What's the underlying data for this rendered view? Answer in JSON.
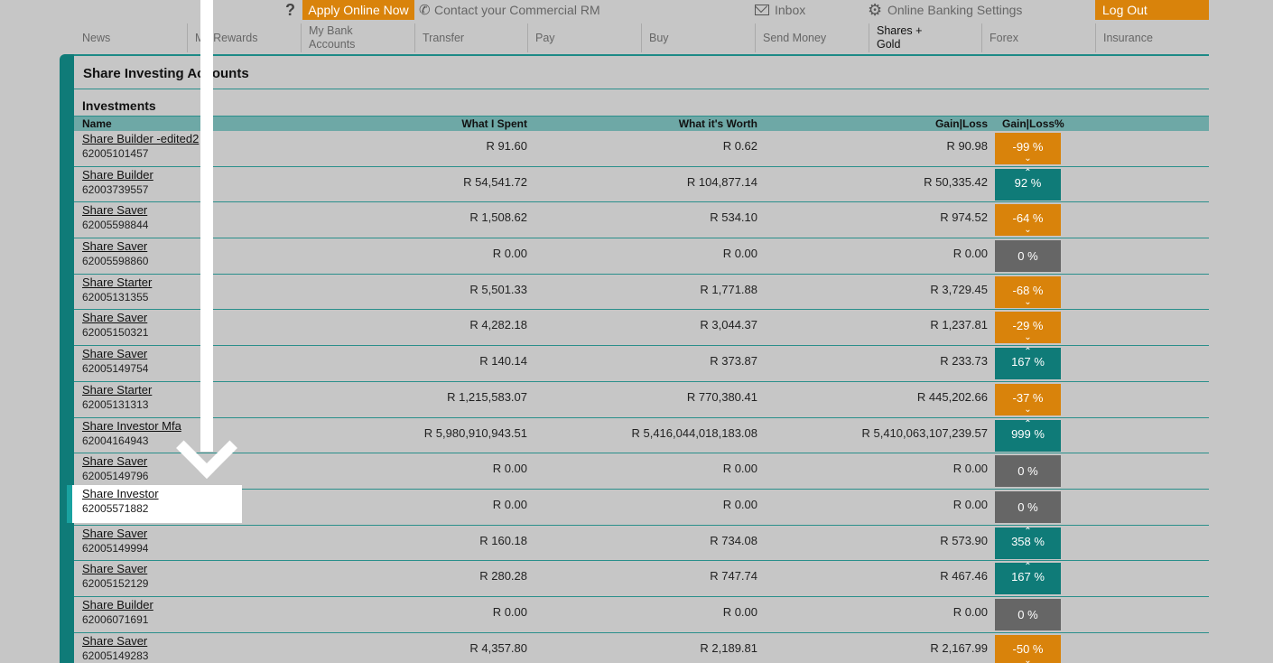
{
  "topbar": {
    "help": "?",
    "apply": "Apply Online Now",
    "contact": "Contact your Commercial RM",
    "inbox": "Inbox",
    "settings": "Online Banking Settings",
    "logout": "Log Out"
  },
  "nav": [
    "News",
    "My Rewards",
    "My Bank\nAccounts",
    "Transfer",
    "Pay",
    "Buy",
    "Send Money",
    "Shares +\nGold",
    "Forex",
    "Insurance"
  ],
  "panel": {
    "title": "Share Investing Accounts",
    "section": "Investments",
    "headers": {
      "name": "Name",
      "spent": "What I Spent",
      "worth": "What it's Worth",
      "gain": "Gain|Loss",
      "pct": "Gain|Loss%"
    }
  },
  "rows": [
    {
      "name": "Share Builder -edited2",
      "acct": "62005101457",
      "spent": "R 91.60",
      "worth": "R 0.62",
      "gain": "R 90.98",
      "pct": "-99 %",
      "kind": "neg"
    },
    {
      "name": "Share Builder",
      "acct": "62003739557",
      "spent": "R 54,541.72",
      "worth": "R 104,877.14",
      "gain": "R 50,335.42",
      "pct": "92 %",
      "kind": "pos"
    },
    {
      "name": "Share Saver",
      "acct": "62005598844",
      "spent": "R 1,508.62",
      "worth": "R 534.10",
      "gain": "R 974.52",
      "pct": "-64 %",
      "kind": "neg"
    },
    {
      "name": "Share Saver",
      "acct": "62005598860",
      "spent": "R 0.00",
      "worth": "R 0.00",
      "gain": "R 0.00",
      "pct": "0 %",
      "kind": "zero"
    },
    {
      "name": "Share Starter",
      "acct": "62005131355",
      "spent": "R 5,501.33",
      "worth": "R 1,771.88",
      "gain": "R 3,729.45",
      "pct": "-68 %",
      "kind": "neg"
    },
    {
      "name": "Share Saver",
      "acct": "62005150321",
      "spent": "R 4,282.18",
      "worth": "R 3,044.37",
      "gain": "R 1,237.81",
      "pct": "-29 %",
      "kind": "neg"
    },
    {
      "name": "Share Saver",
      "acct": "62005149754",
      "spent": "R 140.14",
      "worth": "R 373.87",
      "gain": "R 233.73",
      "pct": "167 %",
      "kind": "pos"
    },
    {
      "name": "Share Starter",
      "acct": "62005131313",
      "spent": "R 1,215,583.07",
      "worth": "R 770,380.41",
      "gain": "R 445,202.66",
      "pct": "-37 %",
      "kind": "neg"
    },
    {
      "name": "Share Investor Mfa",
      "acct": "62004164943",
      "spent": "R 5,980,910,943.51",
      "worth": "R 5,416,044,018,183.08",
      "gain": "R 5,410,063,107,239.57",
      "pct": "999 %",
      "kind": "pos"
    },
    {
      "name": "Share Saver",
      "acct": "62005149796",
      "spent": "R 0.00",
      "worth": "R 0.00",
      "gain": "R 0.00",
      "pct": "0 %",
      "kind": "zero"
    },
    {
      "name": "Share Investor",
      "acct": "62005571882",
      "spent": "R 0.00",
      "worth": "R 0.00",
      "gain": "R 0.00",
      "pct": "0 %",
      "kind": "zero",
      "highlighted": true
    },
    {
      "name": "Share Saver",
      "acct": "62005149994",
      "spent": "R 160.18",
      "worth": "R 734.08",
      "gain": "R 573.90",
      "pct": "358 %",
      "kind": "pos"
    },
    {
      "name": "Share Saver",
      "acct": "62005152129",
      "spent": "R 280.28",
      "worth": "R 747.74",
      "gain": "R 467.46",
      "pct": "167 %",
      "kind": "pos"
    },
    {
      "name": "Share Builder",
      "acct": "62006071691",
      "spent": "R 0.00",
      "worth": "R 0.00",
      "gain": "R 0.00",
      "pct": "0 %",
      "kind": "zero"
    },
    {
      "name": "Share Saver",
      "acct": "62005149283",
      "spent": "R 4,357.80",
      "worth": "R 2,189.81",
      "gain": "R 2,167.99",
      "pct": "-50 %",
      "kind": "neg"
    }
  ],
  "colors": {
    "accent": "#0f7b78",
    "orange": "#d9830b",
    "zero": "#666666",
    "background": "#c6c6c6"
  },
  "icons": {
    "help": "question-icon",
    "phone": "phone-icon",
    "inbox": "envelope-icon",
    "settings": "gear-icon",
    "annotation": "down-arrow-icon"
  }
}
